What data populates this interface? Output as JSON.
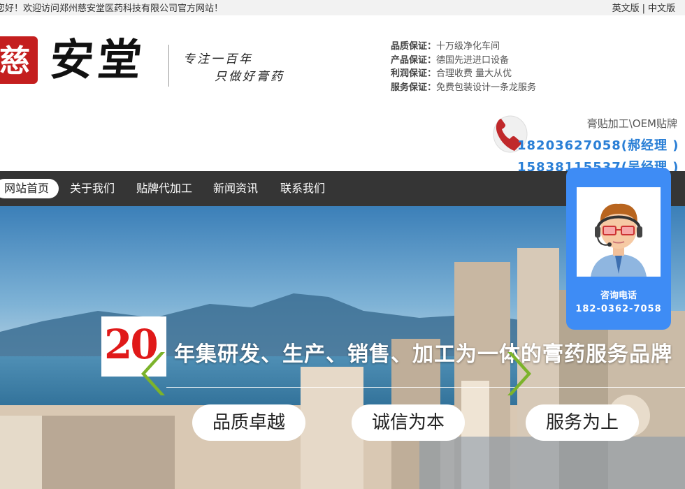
{
  "topbar": {
    "welcome": "您好！欢迎访问郑州慈安堂医药科技有限公司官方网站！",
    "lang_en": "英文版",
    "lang_sep": "|",
    "lang_cn": "中文版"
  },
  "header": {
    "seal_text": "慈",
    "logo_text": "安堂",
    "slogan_line1": "专注一百年",
    "slogan_line2": "只做好膏药",
    "guarantees": [
      {
        "key": "品质保证：",
        "value": "十万级净化车间"
      },
      {
        "key": "产品保证：",
        "value": "德国先进进口设备"
      },
      {
        "key": "利润保证：",
        "value": "合理收费 量大从优"
      },
      {
        "key": "服务保证：",
        "value": "免费包装设计一条龙服务"
      }
    ],
    "hotline_label": "膏贴加工\\OEM贴牌",
    "hotline1": "18203627058(郝经理 )",
    "hotline2": "15838115537(吴经理 )",
    "phone_icon": "phone-icon"
  },
  "nav": {
    "items": [
      {
        "label": "网站首页",
        "active": true
      },
      {
        "label": "关于我们",
        "active": false
      },
      {
        "label": "贴牌代加工",
        "active": false
      },
      {
        "label": "新闻资讯",
        "active": false
      },
      {
        "label": "联系我们",
        "active": false
      }
    ]
  },
  "hero": {
    "badge_number": "20",
    "headline": "年集研发、生产、销售、加工为一体的膏药服务品牌",
    "pills": [
      "品质卓越",
      "诚信为本",
      "服务为上"
    ]
  },
  "service": {
    "label": "咨询电话",
    "phone": "182-0362-7058"
  },
  "colors": {
    "accent_blue": "#2a7fd6",
    "widget_blue": "#3e8cf5",
    "nav_bg": "#353535",
    "badge_red": "#e01919",
    "arrow_green": "#7cb32b"
  }
}
